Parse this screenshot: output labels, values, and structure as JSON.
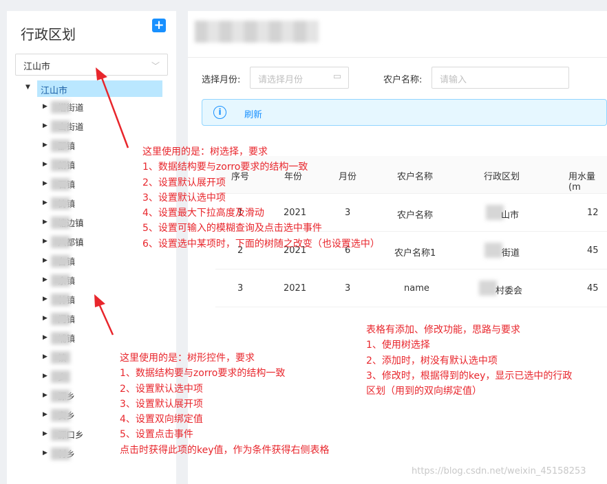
{
  "left": {
    "title": "行政区划",
    "add_icon": "+",
    "select": {
      "value": "江山市",
      "arrow": "﹀"
    },
    "tree": {
      "root": {
        "label": "江山市"
      },
      "children": [
        {
          "label": "塔街道"
        },
        {
          "label": "山街道"
        },
        {
          "label": "邵镇"
        },
        {
          "label": "朗镇"
        },
        {
          "label": "石镇"
        },
        {
          "label": "铸镇"
        },
        {
          "label": "塘边镇"
        },
        {
          "label": "八都镇"
        },
        {
          "label": "台镇"
        },
        {
          "label": "余镇"
        },
        {
          "label": "林镇"
        },
        {
          "label": "门镇"
        },
        {
          "label": "埔镇"
        },
        {
          "label": "镇"
        },
        {
          "label": "乡"
        },
        {
          "label": "源乡"
        },
        {
          "label": "安乡"
        },
        {
          "label": "源口乡"
        },
        {
          "label": "村乡"
        }
      ]
    }
  },
  "filters": {
    "month_label": "选择月份:",
    "month_placeholder": "请选择月份",
    "farmer_label": "农户名称:",
    "farmer_placeholder": "请输入"
  },
  "alert": {
    "info_icon": "i",
    "refresh_label": "刷新"
  },
  "table": {
    "headers": [
      "序号",
      "年份",
      "月份",
      "农户名称",
      "行政区划",
      "用水量(m"
    ],
    "rows": [
      {
        "idx": "1",
        "year": "2021",
        "month": "3",
        "name": "农户名称",
        "region": "山市",
        "usage": "12"
      },
      {
        "idx": "2",
        "year": "2021",
        "month": "6",
        "name": "农户名称1",
        "region": "街道",
        "usage": "45"
      },
      {
        "idx": "3",
        "year": "2021",
        "month": "3",
        "name": "name",
        "region": "村委会",
        "usage": "45"
      }
    ]
  },
  "annotations": {
    "top": [
      "这里使用的是：树选择，要求",
      "1、数据结构要与zorro要求的结构一致",
      "2、设置默认展开项",
      "3、设置默认选中项",
      "4、设置最大下拉高度及滑动",
      "5、设置可输入的模糊查询及点击选中事件",
      "6、设置选中某项时，下面的树随之改变（也设置选中）"
    ],
    "bottom": [
      "这里使用的是：树形控件，要求",
      "1、数据结构要与zorro要求的结构一致",
      "2、设置默认选中项",
      "3、设置默认展开项",
      "4、设置双向绑定值",
      "5、设置点击事件",
      "点击时获得此项的key值，作为条件获得右侧表格"
    ],
    "right": [
      "表格有添加、修改功能，思路与要求",
      "1、使用树选择",
      "2、添加时，树没有默认选中项",
      "3、修改时，根据得到的key，显示已选中的行政",
      "区划（用到的双向绑定值）"
    ]
  },
  "watermark": "https://blog.csdn.net/weixin_45158253",
  "colors": {
    "accent": "#1890ff",
    "annotation": "#e8262c",
    "selected_bg": "#bae7ff"
  }
}
